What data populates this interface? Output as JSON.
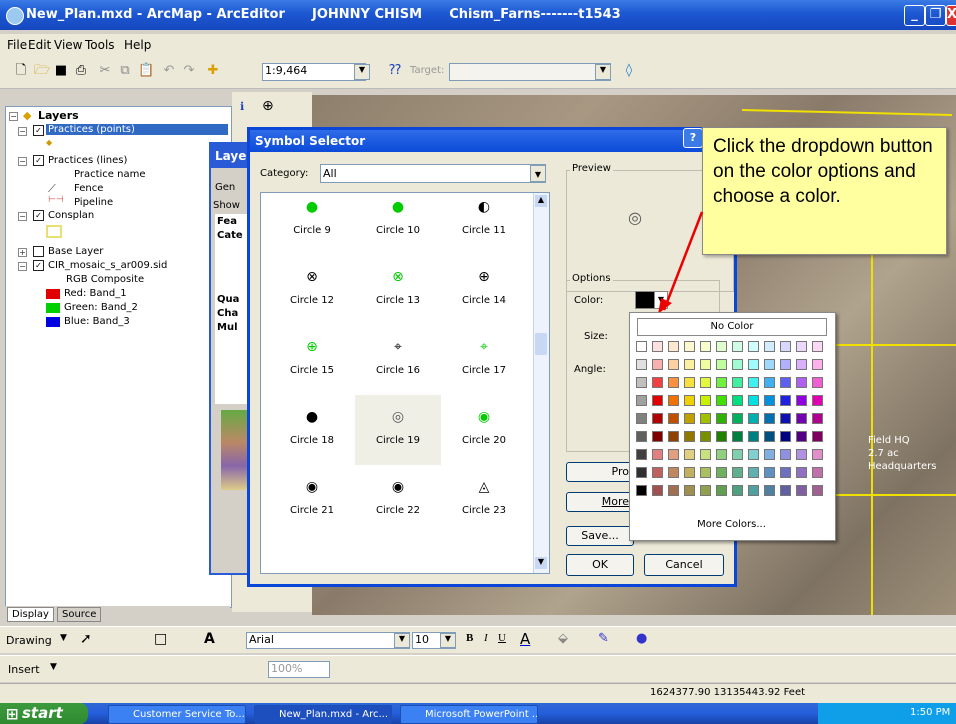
{
  "window": {
    "title": "New_Plan.mxd - ArcMap - ArcEditor      JOHNNY CHISM      Chism_Farns-------t1543"
  },
  "menu": {
    "items": [
      "File",
      "Edit",
      "View",
      "Tools",
      "Help"
    ]
  },
  "toolbar": {
    "scale": "1:9,464",
    "target_label": "Target:"
  },
  "toc": {
    "root": "Layers",
    "rows": [
      {
        "label": "Practices (points)",
        "checked": true,
        "selected": true
      },
      {
        "label": "Practices (lines)",
        "checked": true
      },
      {
        "label": "Practice name"
      },
      {
        "label": "Fence"
      },
      {
        "label": "Pipeline"
      },
      {
        "label": "Consplan",
        "checked": true
      },
      {
        "label": "Base Layer",
        "checked": false
      },
      {
        "label": "CIR_mosaic_s_ar009.sid",
        "checked": true
      },
      {
        "label": "RGB Composite"
      },
      {
        "label": "Red:  Band_1",
        "color": "#e00000"
      },
      {
        "label": "Green: Band_2",
        "color": "#00d000"
      },
      {
        "label": "Blue:  Band_3",
        "color": "#0000e0"
      }
    ],
    "tabs": [
      "Display",
      "Source"
    ]
  },
  "layer_props": {
    "title": "Layer",
    "partials": [
      "Gen",
      "Show",
      "Fea",
      "Cate",
      "Qua",
      "Cha",
      "Mul"
    ]
  },
  "symbol_selector": {
    "title": "Symbol Selector",
    "category_label": "Category:",
    "category_value": "All",
    "preview_label": "Preview",
    "options_label": "Options",
    "color_label": "Color:",
    "size_label": "Size:",
    "angle_label": "Angle:",
    "buttons": {
      "properties": "Pro",
      "more": "More",
      "save": "Save...",
      "ok": "OK",
      "cancel": "Cancel"
    },
    "symbols": [
      {
        "name": "Circle 9"
      },
      {
        "name": "Circle 10"
      },
      {
        "name": "Circle 11"
      },
      {
        "name": "Circle 12"
      },
      {
        "name": "Circle 13"
      },
      {
        "name": "Circle 14"
      },
      {
        "name": "Circle 15"
      },
      {
        "name": "Circle 16"
      },
      {
        "name": "Circle 17"
      },
      {
        "name": "Circle 18"
      },
      {
        "name": "Circle 19"
      },
      {
        "name": "Circle 20"
      },
      {
        "name": "Circle 21"
      },
      {
        "name": "Circle 22"
      },
      {
        "name": "Circle 23"
      }
    ]
  },
  "callout": {
    "text": "Click the dropdown button on the color options and choose a color."
  },
  "palette": {
    "no_color": "No Color",
    "more_colors": "More Colors...",
    "rows": [
      [
        "#ffffff",
        "#fde0e0",
        "#fde9d0",
        "#fdf8d0",
        "#f8fdd0",
        "#e0fdd0",
        "#d0fde8",
        "#d0fdfd",
        "#d0ecfd",
        "#d8d8fd",
        "#ead8fd",
        "#fdd8f4"
      ],
      [
        "#e0e0e0",
        "#fbb0b0",
        "#fcd0a0",
        "#fcf0a0",
        "#f0fca0",
        "#c0fca0",
        "#a0fcd0",
        "#a0fcfc",
        "#a0d8fc",
        "#b0b0fc",
        "#d8b0fc",
        "#fcb0ec"
      ],
      [
        "#c0c0c0",
        "#f04040",
        "#f89040",
        "#f8e040",
        "#e0f840",
        "#70f040",
        "#40f0a0",
        "#40f0f0",
        "#40b0f0",
        "#6060f0",
        "#b060f0",
        "#f060d0"
      ],
      [
        "#a0a0a0",
        "#e00000",
        "#f07000",
        "#f0d000",
        "#c8f000",
        "#40e000",
        "#00e080",
        "#00e0e0",
        "#0090e0",
        "#2020e0",
        "#9000e0",
        "#e000b0"
      ],
      [
        "#808080",
        "#b00000",
        "#c05000",
        "#c0a000",
        "#a0c000",
        "#30b000",
        "#00b060",
        "#00b0b0",
        "#0070b0",
        "#1010b0",
        "#7000b0",
        "#b00090"
      ],
      [
        "#606060",
        "#800000",
        "#904000",
        "#907800",
        "#789000",
        "#208000",
        "#008040",
        "#008080",
        "#005080",
        "#000080",
        "#500080",
        "#800060"
      ],
      [
        "#404040",
        "#e08080",
        "#e0a080",
        "#e0d080",
        "#c8e080",
        "#90d080",
        "#80d0b0",
        "#80d0d0",
        "#80b0e0",
        "#9090e0",
        "#b090e0",
        "#e090c8"
      ],
      [
        "#303030",
        "#c06060",
        "#c08860",
        "#c0b060",
        "#a8c060",
        "#70b060",
        "#60b090",
        "#60b0b0",
        "#6090c0",
        "#7070c0",
        "#9070c0",
        "#c070a8"
      ],
      [
        "#000000",
        "#a05050",
        "#a07050",
        "#a09050",
        "#90a050",
        "#60a050",
        "#50a080",
        "#50a0a0",
        "#5080a0",
        "#6060a0",
        "#8060a0",
        "#a06090"
      ]
    ]
  },
  "map_labels": {
    "field": "Field  HQ",
    "acres": "2.7 ac",
    "hq": "Headquarters"
  },
  "drawing_toolbar": {
    "drawing": "Drawing",
    "font": "Arial",
    "size": "10",
    "insert": "Insert",
    "zoom": "100%"
  },
  "status": {
    "coords": "1624377.90  13135443.92 Feet"
  },
  "taskbar": {
    "start": "start",
    "tasks": [
      "Customer Service To...",
      "New_Plan.mxd - Arc...",
      "Microsoft PowerPoint ..."
    ],
    "time": "1:50 PM"
  }
}
